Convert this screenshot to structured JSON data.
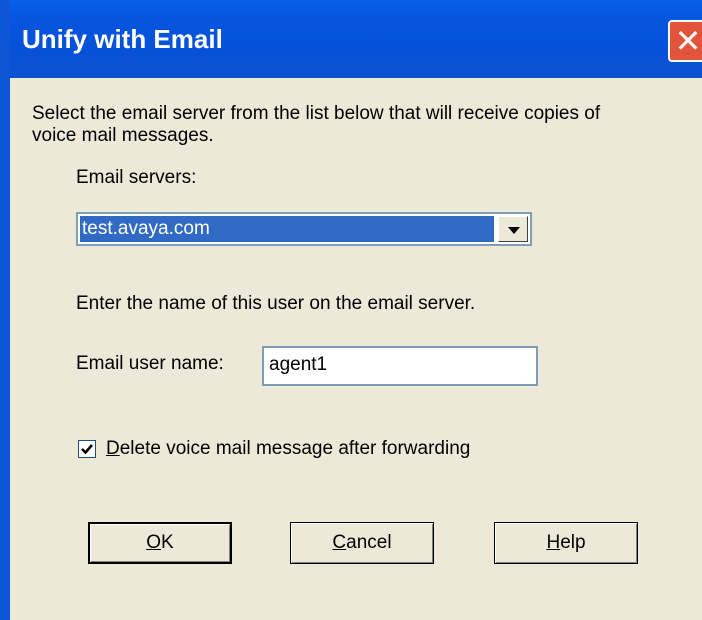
{
  "window": {
    "title": "Unify with Email"
  },
  "dialog": {
    "intro_line1": "Select the email server from the list below that will receive copies of",
    "intro_line2": "voice mail messages.",
    "email_servers_label": "Email servers:",
    "email_server_selected": "test.avaya.com",
    "user_prompt": "Enter the name of this user on the email server.",
    "email_user_label": "Email user name:",
    "email_user_value": "agent1",
    "delete_checkbox": {
      "checked": true,
      "mnemonic": "D",
      "label_rest": "elete voice mail message after forwarding"
    },
    "buttons": {
      "ok_mnemonic": "O",
      "ok_rest": "K",
      "cancel_mnemonic": "C",
      "cancel_rest": "ancel",
      "help_mnemonic": "H",
      "help_rest": "elp"
    }
  },
  "icons": {
    "close": "close-icon",
    "dropdown": "chevron-down-icon",
    "check": "checkmark-icon"
  },
  "colors": {
    "titlebar": "#0651DA",
    "selection": "#316AC5",
    "dialog_bg": "#ECE9D8",
    "close_button": "#E2533C"
  }
}
